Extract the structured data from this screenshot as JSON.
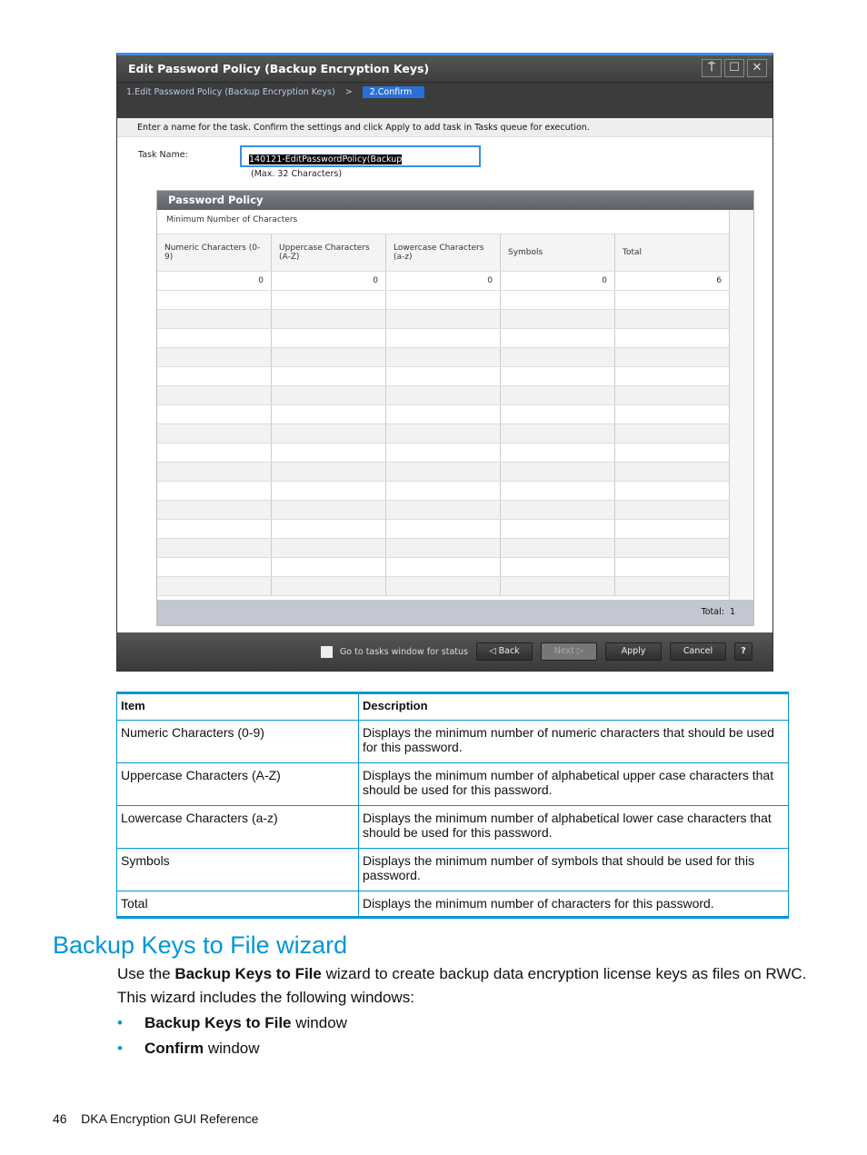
{
  "dialog": {
    "title": "Edit Password Policy (Backup Encryption Keys)",
    "steps": [
      "1.Edit Password Policy (Backup Encryption Keys)",
      "2.Confirm"
    ],
    "step_sep": ">",
    "instruction": "Enter a name for the task. Confirm the settings and click Apply to add task in Tasks queue for execution.",
    "task_name_label": "Task Name:",
    "task_name_value": "140121-EditPasswordPolicy(Backup",
    "task_name_hint": "(Max. 32 Characters)",
    "panel_title": "Password Policy",
    "group_header": "Minimum Number of Characters",
    "columns": [
      "Numeric Characters (0-9)",
      "Uppercase Characters (A-Z)",
      "Lowercase Characters (a-z)",
      "Symbols",
      "Total"
    ],
    "values": [
      "0",
      "0",
      "0",
      "0",
      "6"
    ],
    "total_label": "Total:",
    "total_value": "1",
    "checkbox_label": "Go to tasks window for status",
    "buttons": {
      "back": "Back",
      "next": "Next",
      "apply": "Apply",
      "cancel": "Cancel",
      "help": "?"
    }
  },
  "table": {
    "headers": [
      "Item",
      "Description"
    ],
    "rows": [
      [
        "Numeric Characters (0-9)",
        "Displays the minimum number of numeric characters that should be used for this password."
      ],
      [
        "Uppercase Characters (A-Z)",
        "Displays the minimum number of alphabetical upper case characters that should be used for this password."
      ],
      [
        "Lowercase Characters (a-z)",
        "Displays the minimum number of alphabetical lower case characters that should be used for this password."
      ],
      [
        "Symbols",
        "Displays the minimum number of symbols that should be used for this password."
      ],
      [
        "Total",
        "Displays the minimum number of characters for this password."
      ]
    ]
  },
  "section": {
    "title": "Backup Keys to File wizard",
    "p1_a": "Use the ",
    "p1_b": "Backup Keys to File",
    "p1_c": " wizard to create backup data encryption license keys as files on RWC.",
    "p2": "This wizard includes the following windows:",
    "bullets": [
      {
        "bold": "Backup Keys to File",
        "rest": " window"
      },
      {
        "bold": "Confirm",
        "rest": " window"
      }
    ]
  },
  "footer": {
    "page": "46",
    "title": "DKA Encryption GUI Reference"
  }
}
